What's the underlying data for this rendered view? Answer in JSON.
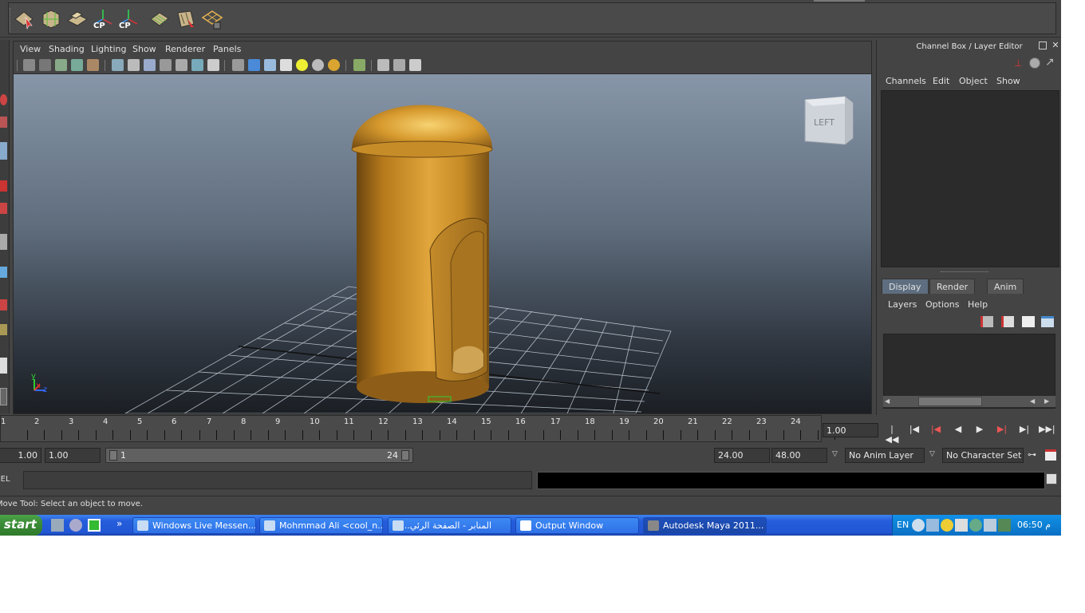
{
  "viewport": {
    "menu": [
      "View",
      "Shading",
      "Lighting",
      "Show",
      "Renderer",
      "Panels"
    ],
    "view_cube_label": "LEFT",
    "axis_y": "y",
    "axis_x": "x",
    "axis_z": "z"
  },
  "shelf": {
    "cp_label_1": "CP",
    "cp_label_2": "CP"
  },
  "channel_box": {
    "title": "Channel Box / Layer Editor",
    "menu": [
      "Channels",
      "Edit",
      "Object",
      "Show"
    ]
  },
  "layer_editor": {
    "tabs": [
      "Display",
      "Render",
      "Anim"
    ],
    "active_tab": "Display",
    "menu": [
      "Layers",
      "Options",
      "Help"
    ]
  },
  "time_slider": {
    "first_tick": "1",
    "ticks": [
      "2",
      "3",
      "4",
      "5",
      "6",
      "7",
      "8",
      "9",
      "10",
      "11",
      "12",
      "13",
      "14",
      "15",
      "16",
      "17",
      "18",
      "19",
      "20",
      "21",
      "22",
      "23",
      "24"
    ],
    "current_frame": "1.00"
  },
  "range_slider": {
    "start_time": "1.00",
    "playback_start": "1.00",
    "range_min": "1",
    "range_max": "24",
    "playback_end": "24.00",
    "end_time": "48.00",
    "anim_layer": "No Anim Layer",
    "character_set": "No Character Set"
  },
  "command_line": {
    "label": "MEL",
    "help_line": "Move Tool: Select an object to move."
  },
  "taskbar": {
    "start_label": "start",
    "tasks": [
      {
        "label": "Windows Live Messen..."
      },
      {
        "label": "Mohmmad Ali <cool_n..."
      },
      {
        "label": "المنابر - الصفحة الرئي..."
      },
      {
        "label": "Output Window"
      },
      {
        "label": "Autodesk Maya 2011..."
      }
    ],
    "language": "EN",
    "clock": "06:50 م"
  },
  "colors": {
    "app_bg": "#444444",
    "object_gold": "#d79a2e",
    "taskbar_blue": "#245ddb",
    "start_green": "#3b8c37"
  }
}
